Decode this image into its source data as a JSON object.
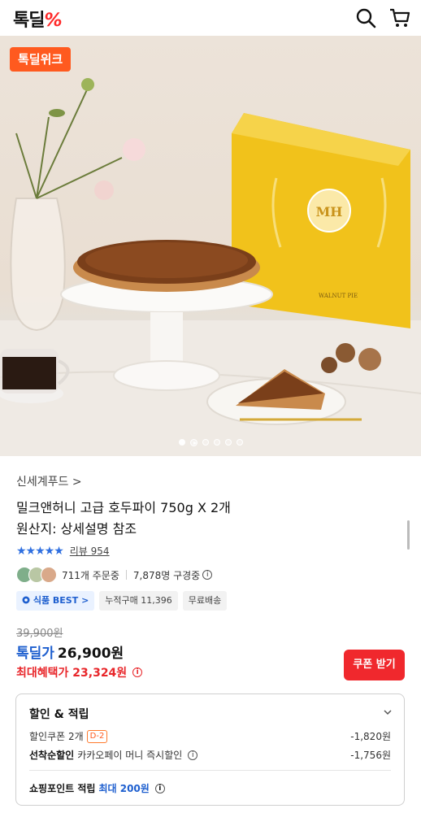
{
  "header": {
    "logo_text": "톡딜",
    "logo_mark": "%",
    "search_icon": "search-icon",
    "cart_icon": "cart-icon"
  },
  "hero": {
    "badge": "톡딜위크",
    "box_brand": "MH",
    "box_label": "WALNUT PIE",
    "slide_count": 6,
    "active_slide": 1
  },
  "product": {
    "seller": "신세계푸드 >",
    "title": "밀크앤허니 고급 호두파이 750g X 2개",
    "origin": "원산지: 상세설명 참조",
    "rating_stars": "★★★★★",
    "review_text": "리뷰 954",
    "orders_text": "711개 주문중",
    "buyers_text": "7,878명 구경중"
  },
  "chips": [
    {
      "label": "식품 BEST >",
      "kind": "best"
    },
    {
      "label": "누적구매 11,396",
      "kind": "plain"
    },
    {
      "label": "무료배송",
      "kind": "plain"
    }
  ],
  "price": {
    "original": "39,900원",
    "deal_label": "톡딜가",
    "deal_price": "26,900원",
    "max_benefit": "최대혜택가 23,324원",
    "coupon_button": "쿠폰 받기"
  },
  "discounts": {
    "title": "할인 & 적립",
    "rows": [
      {
        "label": "할인쿠폰 2개",
        "badge": "D-2",
        "value": "-1,820원"
      },
      {
        "label_bold": "선착순할인",
        "label": "카카오페이 머니 즉시할인",
        "value": "-1,756원"
      }
    ],
    "point_label": "쇼핑포인트 적립",
    "point_value": "최대 200원"
  },
  "colors": {
    "accent_red": "#f0282d",
    "brand_orange": "#ff5a1f",
    "deal_blue": "#1e5fcf",
    "star_blue": "#2f6fe0"
  }
}
